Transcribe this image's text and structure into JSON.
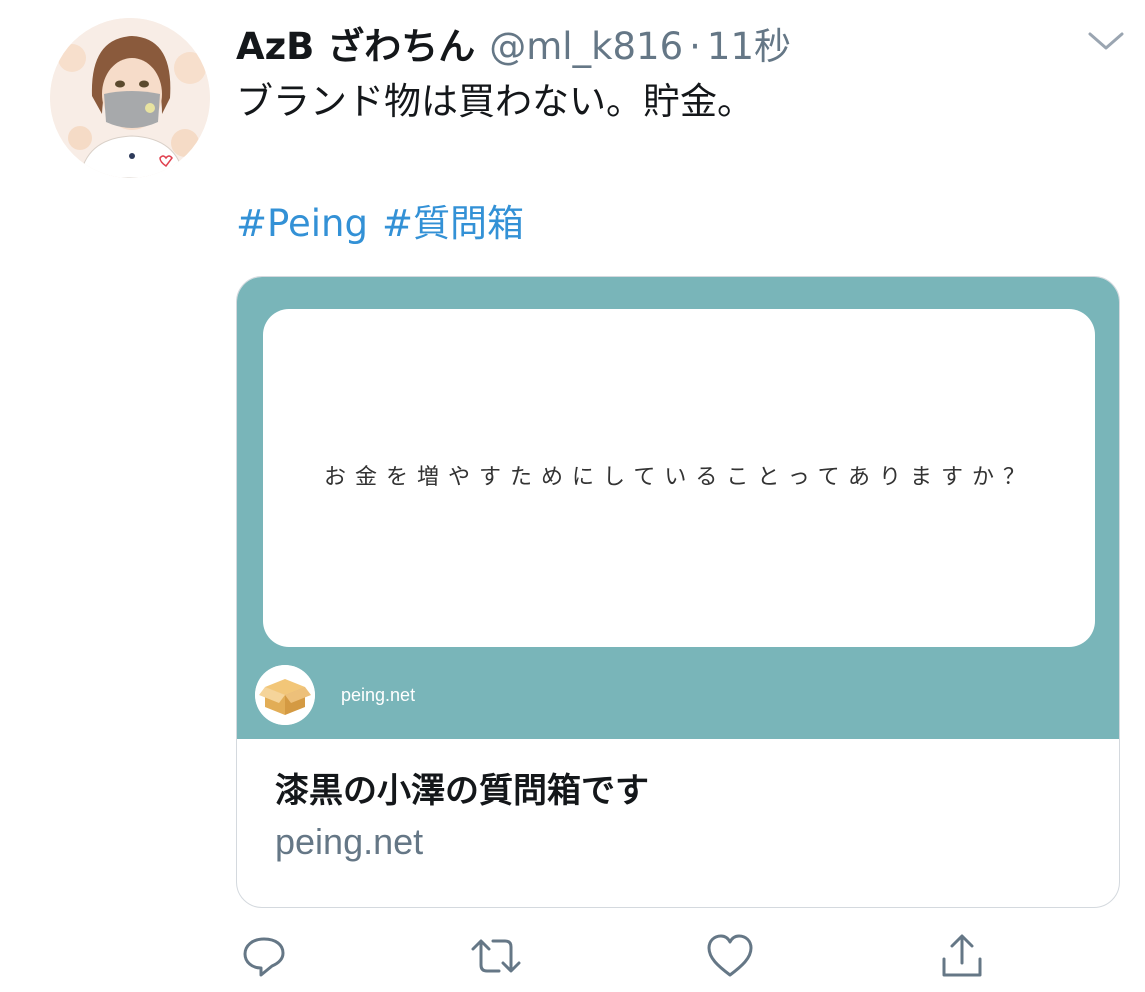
{
  "tweet": {
    "display_name": "AzB ざわちん",
    "handle": "@ml_k816",
    "separator": "·",
    "time": "11秒",
    "text": "ブランド物は買わない。貯金。",
    "hashtags": [
      "#Peing",
      "#質問箱"
    ]
  },
  "card": {
    "question": "お金を増やすためにしていることってありますか？",
    "source_domain": "peing.net",
    "title": "漆黒の小澤の質問箱です",
    "domain": "peing.net",
    "image_background": "#79b5b9"
  },
  "actions": {
    "reply_icon": "reply-icon",
    "retweet_icon": "retweet-icon",
    "like_icon": "heart-icon",
    "share_icon": "share-icon"
  },
  "colors": {
    "link": "#3391d6",
    "secondary_text": "#657786",
    "icon": "#657786"
  }
}
